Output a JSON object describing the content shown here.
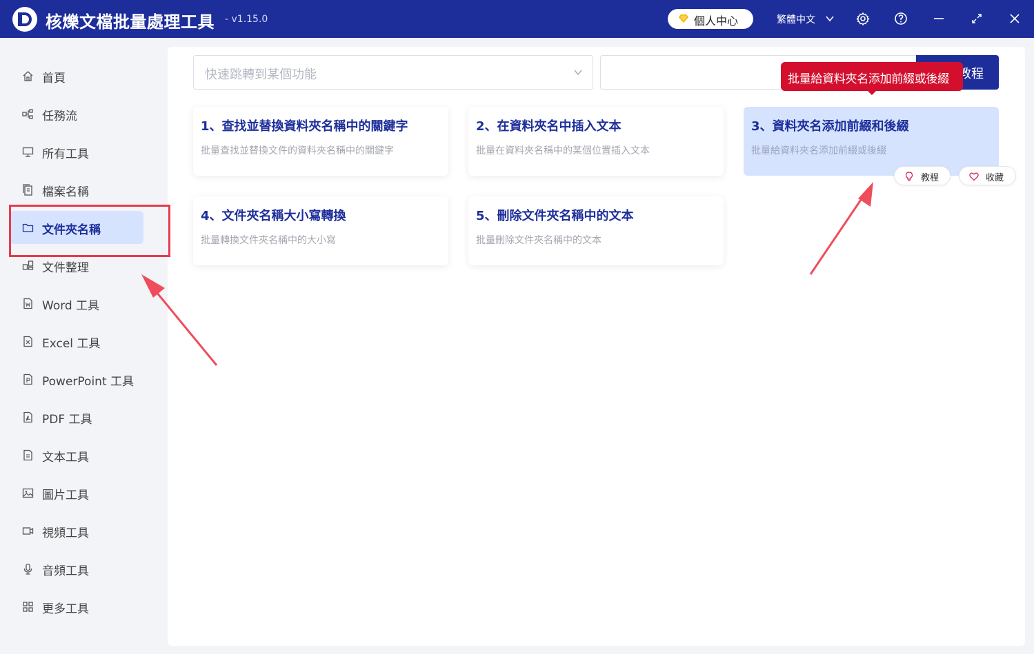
{
  "app": {
    "title": "核爍文檔批量處理工具",
    "version": "- v1.15.0",
    "user_center": "個人中心",
    "language": "繁體中文"
  },
  "colors": {
    "brand": "#1d2e9b",
    "active_bg": "#d6e3ff",
    "tooltip": "#d40f2e",
    "annotation": "#e9394d"
  },
  "sidebar": {
    "items": [
      {
        "label": "首頁",
        "icon": "home-icon"
      },
      {
        "label": "任務流",
        "icon": "workflow-icon"
      },
      {
        "label": "所有工具",
        "icon": "monitor-icon"
      },
      {
        "label": "檔案名稱",
        "icon": "file-copy-icon"
      },
      {
        "label": "文件夾名稱",
        "icon": "folder-icon",
        "active": true
      },
      {
        "label": "文件整理",
        "icon": "organize-icon"
      },
      {
        "label": "Word 工具",
        "icon": "word-file-icon"
      },
      {
        "label": "Excel 工具",
        "icon": "excel-file-icon"
      },
      {
        "label": "PowerPoint 工具",
        "icon": "ppt-file-icon"
      },
      {
        "label": "PDF 工具",
        "icon": "pdf-file-icon"
      },
      {
        "label": "文本工具",
        "icon": "text-file-icon"
      },
      {
        "label": "圖片工具",
        "icon": "image-icon"
      },
      {
        "label": "視頻工具",
        "icon": "video-icon"
      },
      {
        "label": "音頻工具",
        "icon": "microphone-icon"
      },
      {
        "label": "更多工具",
        "icon": "grid-icon"
      }
    ]
  },
  "search": {
    "placeholder": "快速跳轉到某個功能",
    "tutorial_button": "教程"
  },
  "cards": [
    {
      "title": "1、查找並替換資料夾名稱中的關鍵字",
      "desc": "批量查找並替換文件的資料夾名稱中的關鍵字"
    },
    {
      "title": "2、在資料夾名中插入文本",
      "desc": "批量在資料夾名稱中的某個位置插入文本"
    },
    {
      "title": "3、資料夾名添加前綴和後綴",
      "desc": "批量給資料夾名添加前綴或後綴",
      "hovered": true
    },
    {
      "title": "4、文件夾名稱大小寫轉換",
      "desc": "批量轉換文件夾名稱中的大小寫"
    },
    {
      "title": "5、刪除文件夾名稱中的文本",
      "desc": "批量刪除文件夾名稱中的文本"
    }
  ],
  "card_actions": {
    "tutorial": "教程",
    "favorite": "收藏"
  },
  "tooltip": {
    "text": "批量給資料夾名添加前綴或後綴"
  }
}
